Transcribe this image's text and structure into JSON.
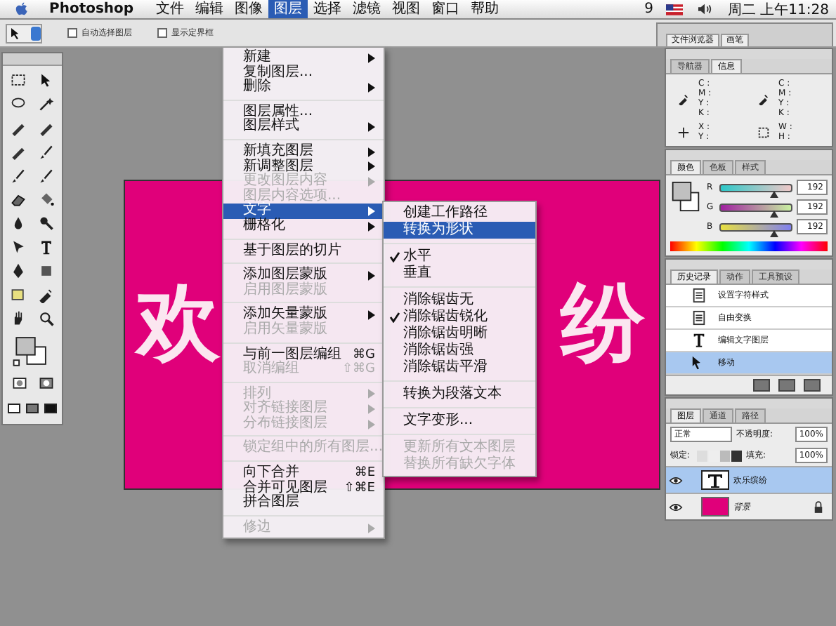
{
  "menubar": {
    "app": "Photoshop",
    "items": [
      {
        "label": "文件",
        "selected": false
      },
      {
        "label": "编辑",
        "selected": false
      },
      {
        "label": "图像",
        "selected": false
      },
      {
        "label": "图层",
        "selected": true
      },
      {
        "label": "选择",
        "selected": false
      },
      {
        "label": "滤镜",
        "selected": false
      },
      {
        "label": "视图",
        "selected": false
      },
      {
        "label": "窗口",
        "selected": false
      },
      {
        "label": "帮助",
        "selected": false
      }
    ],
    "status_number": "9",
    "clock": "周二 上午11:28"
  },
  "options_bar": {
    "checkboxes": [
      {
        "label": "自动选择图层",
        "checked": false
      },
      {
        "label": "显示定界框",
        "checked": false
      }
    ],
    "palette_well_tabs": [
      "文件浏览器",
      "画笔"
    ]
  },
  "canvas": {
    "visible_text": [
      "欢",
      "纷"
    ]
  },
  "layer_menu": {
    "groups": [
      [
        {
          "label": "新建",
          "disabled": false,
          "submenu": true,
          "selected": false
        },
        {
          "label": "复制图层...",
          "disabled": false,
          "submenu": false,
          "selected": false
        },
        {
          "label": "删除",
          "disabled": false,
          "submenu": true,
          "selected": false
        }
      ],
      [
        {
          "label": "图层属性...",
          "disabled": false,
          "submenu": false,
          "selected": false
        },
        {
          "label": "图层样式",
          "disabled": false,
          "submenu": true,
          "selected": false
        }
      ],
      [
        {
          "label": "新填充图层",
          "disabled": false,
          "submenu": true,
          "selected": false
        },
        {
          "label": "新调整图层",
          "disabled": false,
          "submenu": true,
          "selected": false
        },
        {
          "label": "更改图层内容",
          "disabled": true,
          "submenu": true,
          "selected": false
        },
        {
          "label": "图层内容选项...",
          "disabled": true,
          "submenu": false,
          "selected": false
        },
        {
          "label": "文字",
          "disabled": false,
          "submenu": true,
          "selected": true
        },
        {
          "label": "栅格化",
          "disabled": false,
          "submenu": true,
          "selected": false
        }
      ],
      [
        {
          "label": "基于图层的切片",
          "disabled": false,
          "submenu": false,
          "selected": false
        }
      ],
      [
        {
          "label": "添加图层蒙版",
          "disabled": false,
          "submenu": true,
          "selected": false
        },
        {
          "label": "启用图层蒙版",
          "disabled": true,
          "submenu": false,
          "selected": false
        }
      ],
      [
        {
          "label": "添加矢量蒙版",
          "disabled": false,
          "submenu": true,
          "selected": false
        },
        {
          "label": "启用矢量蒙版",
          "disabled": true,
          "submenu": false,
          "selected": false
        }
      ],
      [
        {
          "label": "与前一图层编组",
          "disabled": false,
          "submenu": false,
          "shortcut": "⌘G",
          "selected": false
        },
        {
          "label": "取消编组",
          "disabled": true,
          "submenu": false,
          "shortcut": "⇧⌘G",
          "selected": false
        }
      ],
      [
        {
          "label": "排列",
          "disabled": true,
          "submenu": true,
          "selected": false
        },
        {
          "label": "对齐链接图层",
          "disabled": true,
          "submenu": true,
          "selected": false
        },
        {
          "label": "分布链接图层",
          "disabled": true,
          "submenu": true,
          "selected": false
        }
      ],
      [
        {
          "label": "锁定组中的所有图层...",
          "disabled": true,
          "submenu": false,
          "selected": false
        }
      ],
      [
        {
          "label": "向下合并",
          "disabled": false,
          "submenu": false,
          "shortcut": "⌘E",
          "selected": false
        },
        {
          "label": "合并可见图层",
          "disabled": false,
          "submenu": false,
          "shortcut": "⇧⌘E",
          "selected": false
        },
        {
          "label": "拼合图层",
          "disabled": false,
          "submenu": false,
          "selected": false
        }
      ],
      [
        {
          "label": "修边",
          "disabled": true,
          "submenu": true,
          "selected": false
        }
      ]
    ]
  },
  "type_submenu": {
    "groups": [
      [
        {
          "label": "创建工作路径",
          "checked": false,
          "disabled": false,
          "selected": false
        },
        {
          "label": "转换为形状",
          "checked": false,
          "disabled": false,
          "selected": true
        }
      ],
      [
        {
          "label": "水平",
          "checked": true,
          "disabled": false,
          "selected": false
        },
        {
          "label": "垂直",
          "checked": false,
          "disabled": false,
          "selected": false
        }
      ],
      [
        {
          "label": "消除锯齿无",
          "checked": false,
          "disabled": false,
          "selected": false
        },
        {
          "label": "消除锯齿锐化",
          "checked": true,
          "disabled": false,
          "selected": false
        },
        {
          "label": "消除锯齿明晰",
          "checked": false,
          "disabled": false,
          "selected": false
        },
        {
          "label": "消除锯齿强",
          "checked": false,
          "disabled": false,
          "selected": false
        },
        {
          "label": "消除锯齿平滑",
          "checked": false,
          "disabled": false,
          "selected": false
        }
      ],
      [
        {
          "label": "转换为段落文本",
          "checked": false,
          "disabled": false,
          "selected": false
        }
      ],
      [
        {
          "label": "文字变形...",
          "checked": false,
          "disabled": false,
          "selected": false
        }
      ],
      [
        {
          "label": "更新所有文本图层",
          "checked": false,
          "disabled": true,
          "selected": false
        },
        {
          "label": "替换所有缺欠字体",
          "checked": false,
          "disabled": true,
          "selected": false
        }
      ]
    ]
  },
  "info_panel": {
    "tabs": [
      {
        "label": "导航器",
        "selected": false
      },
      {
        "label": "信息",
        "selected": true
      }
    ],
    "blocks": [
      [
        "C :",
        "M :",
        "Y :",
        "K :"
      ],
      [
        "C :",
        "M :",
        "Y :",
        "K :"
      ],
      [
        "X :",
        "Y :"
      ],
      [
        "W :",
        "H :"
      ]
    ]
  },
  "color_panel": {
    "tabs": [
      {
        "label": "颜色",
        "selected": true
      },
      {
        "label": "色板",
        "selected": false
      },
      {
        "label": "样式",
        "selected": false
      }
    ],
    "channels": [
      {
        "label": "R",
        "value": "192",
        "level": 0.75
      },
      {
        "label": "G",
        "value": "192",
        "level": 0.75
      },
      {
        "label": "B",
        "value": "192",
        "level": 0.75
      }
    ]
  },
  "history_panel": {
    "tabs": [
      {
        "label": "历史记录",
        "selected": true
      },
      {
        "label": "动作",
        "selected": false
      },
      {
        "label": "工具预设",
        "selected": false
      }
    ],
    "items": [
      {
        "label": "设置字符样式",
        "selected": false
      },
      {
        "label": "自由变换",
        "selected": false
      },
      {
        "label": "编辑文字图层",
        "selected": false
      },
      {
        "label": "移动",
        "selected": true
      }
    ]
  },
  "layers_panel": {
    "tabs": [
      {
        "label": "图层",
        "selected": true
      },
      {
        "label": "通道",
        "selected": false
      },
      {
        "label": "路径",
        "selected": false
      }
    ],
    "blend_mode": "正常",
    "opacity_label": "不透明度:",
    "opacity": "100%",
    "lock_label": "锁定:",
    "fill_label": "填充:",
    "fill": "100%",
    "layers": [
      {
        "name": "欢乐缤纷",
        "kind": "text",
        "visible": true,
        "locked": false,
        "selected": true
      },
      {
        "name": "背景",
        "kind": "fill",
        "visible": true,
        "locked": true,
        "selected": false
      }
    ]
  }
}
